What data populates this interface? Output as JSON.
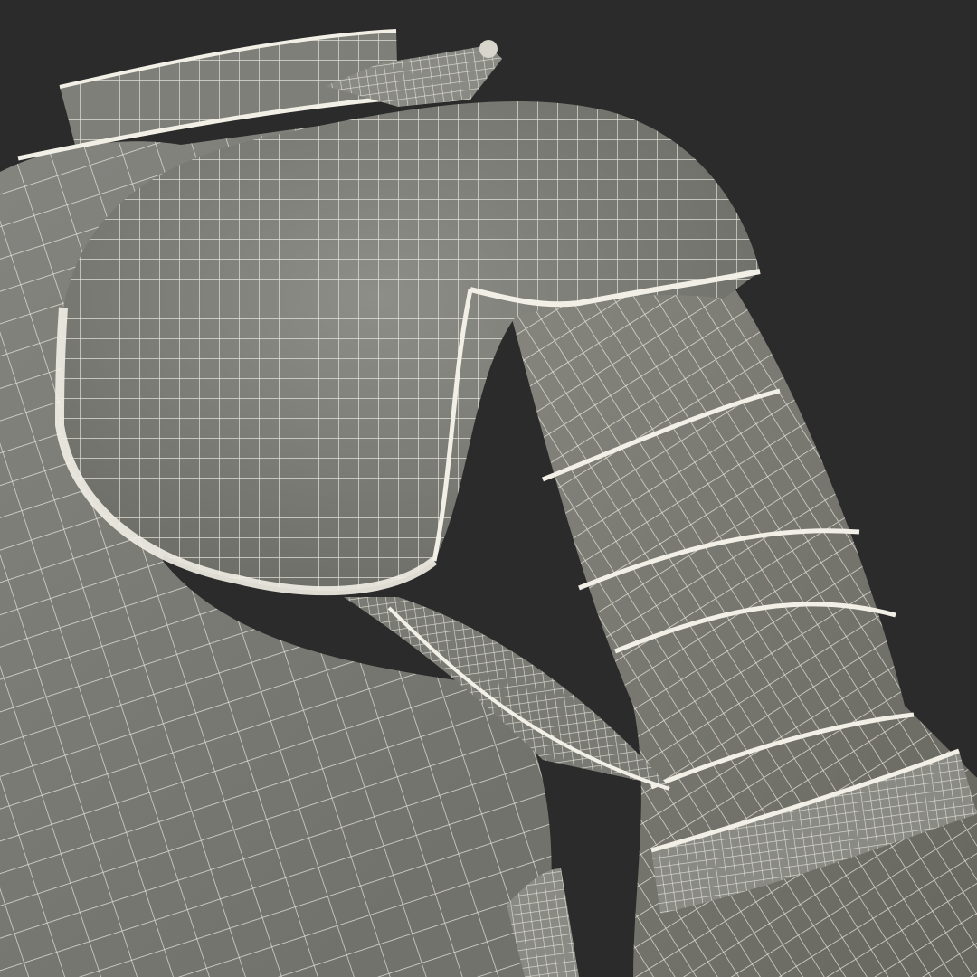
{
  "scene": {
    "subject": "armor-wireframe-render",
    "colors": {
      "background": "#2b2b2b",
      "surface": "#7d7d77",
      "surface_light": "#8e8e88",
      "surface_dark": "#5f5f5a",
      "wire": "#f2f0e6"
    }
  }
}
